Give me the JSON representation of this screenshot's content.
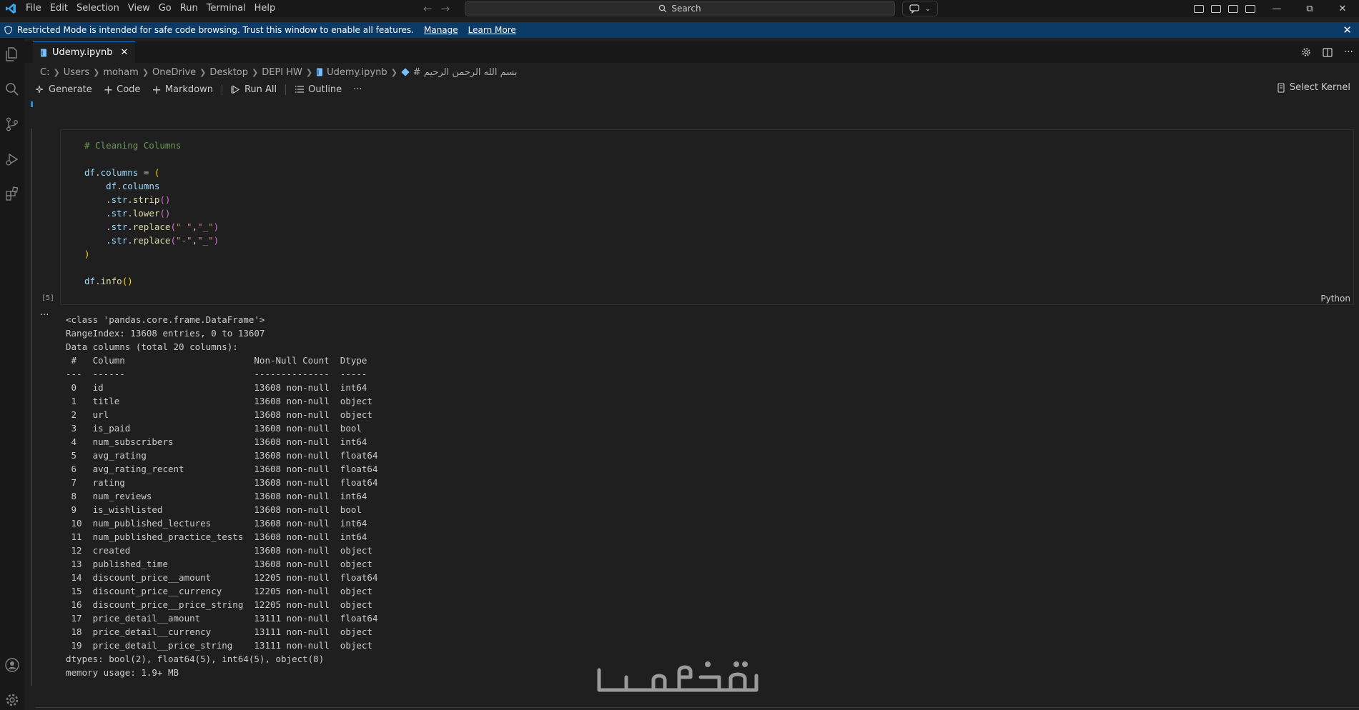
{
  "menu": [
    "File",
    "Edit",
    "Selection",
    "View",
    "Go",
    "Run",
    "Terminal",
    "Help"
  ],
  "search": {
    "label": "Search"
  },
  "banner": {
    "text": "Restricted Mode is intended for safe code browsing. Trust this window to enable all features.",
    "manage": "Manage",
    "learn_more": "Learn More"
  },
  "tab": {
    "label": "Udemy.ipynb"
  },
  "breadcrumb": {
    "parts": [
      "C:",
      "Users",
      "moham",
      "OneDrive",
      "Desktop",
      "DEPI HW"
    ],
    "file": "Udemy.ipynb",
    "section": "# بسم الله الرحمن الرحيم"
  },
  "toolbar": {
    "generate": "Generate",
    "code": "Code",
    "markdown": "Markdown",
    "run_all": "Run All",
    "outline": "Outline",
    "more": "···",
    "select_kernel": "Select Kernel"
  },
  "cell": {
    "execution_count": "[5]",
    "language": "Python",
    "code_lines": [
      "# Cleaning Columns",
      "",
      "df.columns = (",
      "    df.columns",
      "    .str.strip()",
      "    .str.lower()",
      "    .str.replace(\" \",\"_\")",
      "    .str.replace(\"-\",\"_\")",
      ")",
      "",
      "df.info()"
    ],
    "output_dots": "···",
    "output_lines": [
      "<class 'pandas.core.frame.DataFrame'>",
      "RangeIndex: 13608 entries, 0 to 13607",
      "Data columns (total 20 columns):",
      " #   Column                        Non-Null Count  Dtype  ",
      "---  ------                        --------------  -----  ",
      " 0   id                            13608 non-null  int64  ",
      " 1   title                         13608 non-null  object ",
      " 2   url                           13608 non-null  object ",
      " 3   is_paid                       13608 non-null  bool   ",
      " 4   num_subscribers               13608 non-null  int64  ",
      " 5   avg_rating                    13608 non-null  float64",
      " 6   avg_rating_recent             13608 non-null  float64",
      " 7   rating                        13608 non-null  float64",
      " 8   num_reviews                   13608 non-null  int64  ",
      " 9   is_wishlisted                 13608 non-null  bool   ",
      " 10  num_published_lectures        13608 non-null  int64  ",
      " 11  num_published_practice_tests  13608 non-null  int64  ",
      " 12  created                       13608 non-null  object ",
      " 13  published_time                13608 non-null  object ",
      " 14  discount_price__amount        12205 non-null  float64",
      " 15  discount_price__currency      12205 non-null  object ",
      " 16  discount_price__price_string  12205 non-null  object ",
      " 17  price_detail__amount          13111 non-null  float64",
      " 18  price_detail__currency        13111 non-null  object ",
      " 19  price_detail__price_string    13111 non-null  object ",
      "dtypes: bool(2), float64(5), int64(5), object(8)",
      "memory usage: 1.9+ MB"
    ]
  },
  "watermark": {
    "text": "خمسات"
  },
  "colors": {
    "accent": "#0078d4",
    "banner_bg": "#0b3a66",
    "editor_bg": "#1f1f1f",
    "chrome_bg": "#181818"
  }
}
